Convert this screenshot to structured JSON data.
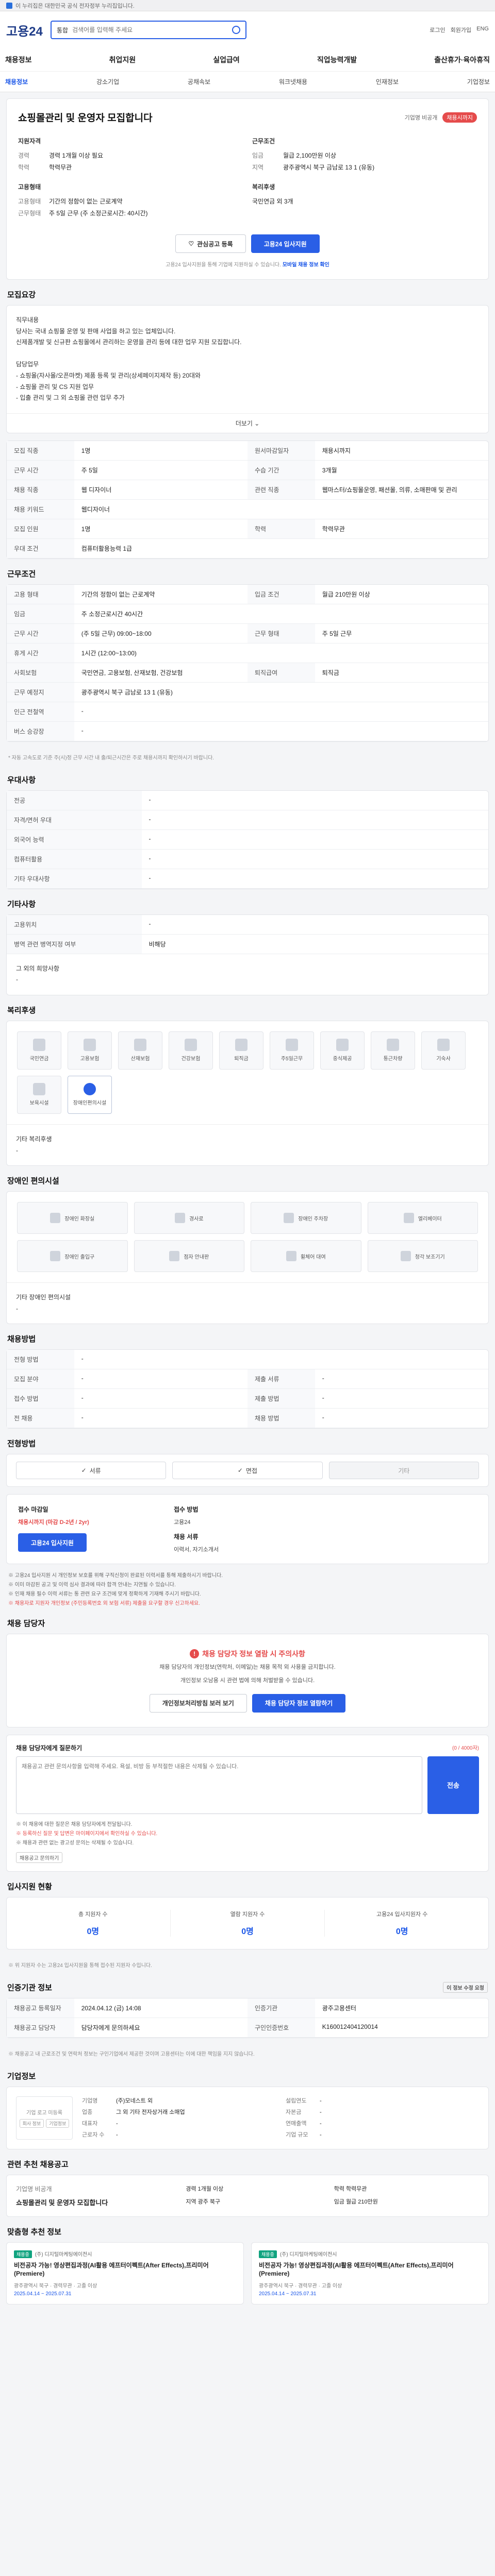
{
  "topbar": {
    "text": "이 누리집은 대한민국 공식 전자정부 누리집입니다."
  },
  "header": {
    "logo": "고용24",
    "search_select": "통합",
    "search_placeholder": "검색어를 입력해 주세요",
    "util": [
      "로그인",
      "회원가입",
      "ENG"
    ]
  },
  "gnb": [
    "채용정보",
    "취업지원",
    "실업급여",
    "직업능력개발",
    "출산휴가·육아휴직"
  ],
  "lnb": [
    "채용정보",
    "강소기업",
    "공채속보",
    "워크넷채용",
    "인재정보",
    "기업정보"
  ],
  "job": {
    "title": "쇼핑몰관리 및 운영자 모집합니다",
    "badge": "채용시까지",
    "company_label": "기업명 비공개",
    "left_title": "지원자격",
    "right_title": "근무조건",
    "left_rows": [
      {
        "k": "경력",
        "v": "경력 1개월 이상 필요"
      },
      {
        "k": "학력",
        "v": "학력무관"
      }
    ],
    "right_rows": [
      {
        "k": "임금",
        "v": "월급 2,100만원 이상"
      },
      {
        "k": "지역",
        "v": "광주광역시 북구 금남로 13 1 (유동)"
      }
    ],
    "left_title2": "고용형태",
    "right_title2": "복리후생",
    "left_rows2": [
      {
        "k": "고용형태",
        "v": "기간의 정함이 없는 근로계약"
      },
      {
        "k": "근무형태",
        "v": "주 5일 근무 (주 소정근로시간: 40시간)"
      }
    ],
    "right_rows2": [
      {
        "k": "",
        "v": "국민연금 외 3개"
      }
    ],
    "btn_scrap": "관심공고 등록",
    "btn_apply": "고용24 입사지원",
    "notice_pre": "고용24 입사지원을 통해 기업에 지원하실 수 있습니다.",
    "notice_link": "모바일 채용 정보 확인"
  },
  "sec_detail": {
    "title": "모집요강",
    "body": [
      "직무내용",
      "당사는 국내 쇼핑몰 운영 및 판매 사업을 하고 있는 업체입니다.",
      "신제품개발 및 신규판 쇼핑몰에서 관리하는 운영을 관리 등에 대한 업무 지원 모집합니다.",
      "",
      "담당업무",
      "- 쇼핑몰(자사몰/오픈마켓) 제품 등록 및 관리(상세페이지제작 등) 20대와",
      "- 쇼핑몰 관리 및 CS 지원 업무",
      "- 입출 관리 및 그 외 쇼핑몰 관련 업무 추가"
    ],
    "more": "더보기"
  },
  "kv1": [
    [
      "모집 직종",
      "1명",
      "원서마감일자",
      "채용시까지"
    ],
    [
      "근무 시간",
      "주 5일",
      "수습 기간",
      "3개월"
    ],
    [
      "채용 직종",
      "웹 디자이너",
      "관련 직종",
      "웹마스터/쇼핑몰운영, 패션몰, 의류, 소매판매 및 관리"
    ],
    [
      "채용 키워드",
      "웹디자이너",
      "",
      ""
    ],
    [
      "모집 인원",
      "1명",
      "학력",
      "학력무관"
    ],
    [
      "우대 조건",
      "컴퓨터활용능력 1급",
      "",
      ""
    ]
  ],
  "conditions": {
    "title": "근무조건",
    "rows": [
      [
        "고용 형태",
        "기간의 정함이 없는 근로계약",
        "입금 조건",
        "월급 210만원 이상"
      ],
      [
        "임금",
        "주 소정근로시간 40시간",
        "",
        ""
      ],
      [
        "근무 시간",
        "(주 5일 근무) 09:00~18:00",
        "근무 형태",
        "주 5일 근무"
      ],
      [
        "휴게 시간",
        "1시간 (12:00~13:00)",
        "",
        ""
      ],
      [
        "사회보험",
        "국민연금, 고용보험, 산재보험, 건강보험",
        "퇴직급여",
        "퇴직금"
      ],
      [
        "근무 예정지",
        "광주광역시 북구 금남로 13 1 (유동)",
        "",
        ""
      ],
      [
        "인근 전철역",
        "-",
        "",
        ""
      ],
      [
        "버스 승강장",
        "-",
        "",
        ""
      ]
    ],
    "footnote": "* 자동 고속도로 기준 주(시)정 근무 시간 내 출/퇴근시간은 주로 채용시까지 확인하시기 바랍니다."
  },
  "prefer": {
    "title": "우대사항",
    "rows": [
      [
        "전공",
        "-"
      ],
      [
        "자격/면허 우대",
        "-"
      ],
      [
        "외국어 능력",
        "-"
      ],
      [
        "컴퓨터활용",
        "-"
      ],
      [
        "기타 우대사항",
        "-"
      ]
    ]
  },
  "dispatch": {
    "title": "기타사항",
    "rows": [
      [
        "고용위치",
        "-"
      ],
      [
        "병역 관련 병역지정 여부",
        "비해당"
      ]
    ],
    "extra_label": "그 외의 희망사항",
    "extra_value": "-"
  },
  "welfare": {
    "title": "복리후생",
    "tiles": [
      {
        "label": "국민연금",
        "on": false
      },
      {
        "label": "고용보험",
        "on": false
      },
      {
        "label": "산재보험",
        "on": false
      },
      {
        "label": "건강보험",
        "on": false
      },
      {
        "label": "퇴직금",
        "on": false
      },
      {
        "label": "주5일근무",
        "on": false
      },
      {
        "label": "중식제공",
        "on": false
      },
      {
        "label": "통근차량",
        "on": false
      },
      {
        "label": "기숙사",
        "on": false
      },
      {
        "label": "보육시설",
        "on": false
      },
      {
        "label": "장애인편의시설",
        "on": true
      }
    ],
    "etc_label": "기타 복리후생",
    "etc_value": "-"
  },
  "disability": {
    "title": "장애인 편의시설",
    "tiles": [
      "장애인 화장실",
      "경사로",
      "장애인 주차장",
      "엘리베이터",
      "장애인 출입구",
      "점자 안내판",
      "휠체어 대여",
      "청각 보조기기"
    ],
    "etc_label": "기타 장애인 편의시설",
    "etc_value": "-"
  },
  "method": {
    "title": "채용방법",
    "rows": [
      [
        "전형 방법",
        "-",
        "",
        ""
      ],
      [
        "모집 분야",
        "-",
        "제출 서류",
        "-"
      ],
      [
        "접수 방법",
        "-",
        "제출 방법",
        "-"
      ],
      [
        "전 채용",
        "-",
        "채용 방법",
        "-"
      ]
    ]
  },
  "process": {
    "title": "전형방법",
    "steps": [
      {
        "label": "서류",
        "on": true
      },
      {
        "label": "면접",
        "on": true
      },
      {
        "label": "기타",
        "on": false
      }
    ]
  },
  "apply": {
    "c1_title": "접수 마감일",
    "c1_dday": "채용시까지 (마감 D-2년 / 2yr)",
    "c1_btn": "고용24 입사지원",
    "c2_title": "접수 방법",
    "c2_line1": "고용24",
    "c2_title2": "채용 서류",
    "c2_line2": "이력서, 자기소개서",
    "c3_title": "",
    "guide": [
      "※ 고용24 입사지원 시 개인정보 보호를 위해 구직신청이 완료된 이력서를 통해 제출하시기 바랍니다.",
      "※ 이미 마감된 공고 및 이력 심사 결과에 따라 합격 안내는 지연될 수 있습니다.",
      "※ 인재 채용 필수 이력 서류는 통 관련 요구 조건에 맞게 정확하게 기재해 주시기 바랍니다.",
      "※ 채용자로 지원자 개인정보 (주민등록번호 외 보험 서류) 제출을 요구할 경우 신고하세요."
    ]
  },
  "contact": {
    "title": "채용 담당자",
    "warn": "채용 담당자 정보 열람 시 주의사항",
    "p1": "채용 담당자의 개인정보(연락처, 이메일)는 채용 목적 외 사용을 금지합니다.",
    "p2": "개인정보 오남용 시 관련 법에 의해 처벌받을 수 있습니다.",
    "b1": "개인정보처리방침 보러 보기",
    "b2": "채용 담당자 정보 열람하기"
  },
  "question": {
    "title": "채용 담당자에게 질문하기",
    "count": "(0 / 4000자)",
    "placeholder": "채용공고 관련 문의사항을 입력해 주세요. 욕설, 비방 등 부적절한 내용은 삭제될 수 있습니다.",
    "send": "전송",
    "notes": [
      "※ 이 채용에 대한 질문은 채용 담당자에게 전달됩니다.",
      "※ 등록하신 질문 및 답변은 마이페이지에서 확인하실 수 있습니다.",
      "※ 채용과 관련 없는 광고성 문의는 삭제될 수 있습니다."
    ],
    "btn": "채용공고 문의하기"
  },
  "stats": {
    "title": "입사지원 현황",
    "items": [
      {
        "l": "총 지원자 수",
        "n": "0명"
      },
      {
        "l": "열람 지원자 수",
        "n": "0명"
      },
      {
        "l": "고용24 입사지원자 수",
        "n": "0명"
      }
    ],
    "note": "※ 위 지원자 수는 고용24 입사지원을 통해 접수된 지원자 수입니다."
  },
  "meta": {
    "title": "인증기관 정보",
    "btn": "이 정보 수정 요청",
    "rows": [
      [
        "채용공고 등록일자",
        "2024.04.12 (금) 14:08",
        "인증기관",
        "광주고용센터"
      ],
      [
        "채용공고 담당자",
        "담당자에게 문의하세요",
        "구인인증번호",
        "K160012404120014"
      ]
    ],
    "note": "※ 채용공고 내 근로조건 및 연락처 정보는 구인기업에서 제공한 것이며 고용센터는 이에 대한 책임을 지지 않습니다."
  },
  "company": {
    "title": "기업정보",
    "logo_text": "기업 로고 미등록",
    "logo_btns": [
      "회사 정보",
      "기업정보"
    ],
    "rows": [
      [
        "기업명",
        "(주)모네스트 외",
        "설립연도",
        "-"
      ],
      [
        "업종",
        "그 외 기타 전자상거래 소매업",
        "자본금",
        "-"
      ],
      [
        "대표자",
        "-",
        "연매출액",
        "-"
      ],
      [
        "근로자 수",
        "-",
        "기업 규모",
        "-"
      ]
    ]
  },
  "recommend": {
    "title": "관련 추천 채용공고",
    "sub": "기업명 비공개",
    "job": "쇼핑몰관리 및 운영자 모집합니다",
    "right": [
      [
        "경력",
        "1개월 이상"
      ],
      [
        "학력",
        "학력무관"
      ],
      [
        "지역",
        "광주 북구"
      ],
      [
        "임금",
        "월급 210만원"
      ]
    ],
    "btns": [
      "이전",
      "다음",
      "목록보기"
    ]
  },
  "ads": {
    "title": "맞춤형 추천 정보",
    "items": [
      {
        "tag": "채용중",
        "co": "(주) 디지털마케팅에이전시",
        "title": "비전공자 가능! 영상편집과정(AI활용 에프터이펙트(After Effects),프리미어(Premiere)",
        "meta": "광주광역시 북구 · 경력무관 · 고졸 이상",
        "date": "2025.04.14 ~ 2025.07.31"
      },
      {
        "tag": "채용중",
        "co": "(주) 디지털마케팅에이전시",
        "title": "비전공자 가능! 영상편집과정(AI활용 에프터이펙트(After Effects),프리미어(Premiere)",
        "meta": "광주광역시 북구 · 경력무관 · 고졸 이상",
        "date": "2025.04.14 ~ 2025.07.31"
      }
    ]
  }
}
